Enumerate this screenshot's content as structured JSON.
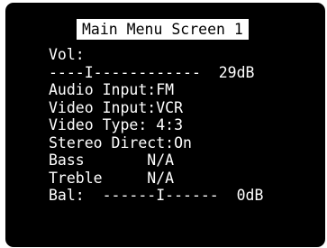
{
  "screen": {
    "title": "Main Menu Screen 1",
    "lines": [
      "Vol:",
      "----I------------  29dB",
      "Audio Input:FM",
      "Video Input:VCR",
      "Video Type: 4:3",
      "Stereo Direct:On",
      "Bass       N/A",
      "Treble     N/A",
      "Bal:  ------I------  0dB"
    ]
  },
  "colors": {
    "background": "#000000",
    "text": "#ffffff",
    "title_background": "#ffffff",
    "title_text": "#000000"
  }
}
